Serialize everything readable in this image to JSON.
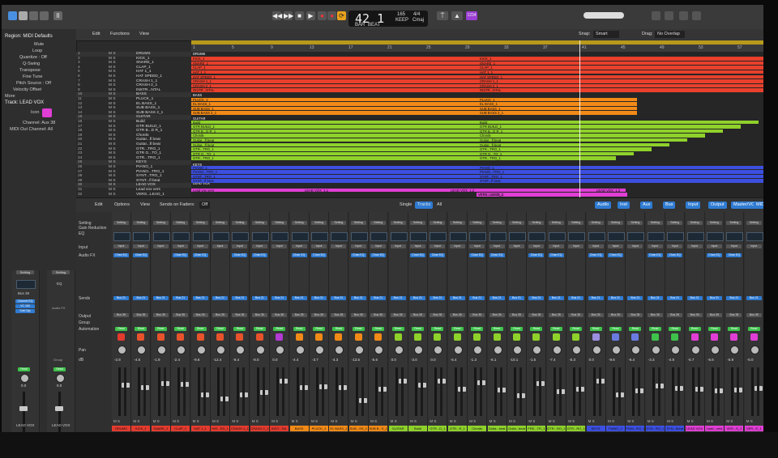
{
  "control_bar": {
    "position": "42 1",
    "bar_label": "BAR",
    "beat_label": "BEAT",
    "tempo": "165",
    "tempo_label": "KEEP",
    "time_signature": "4/4",
    "key": "Cmaj",
    "tempo_sub": "TEMPO",
    "cpu_badge": "1234",
    "transport_icons": [
      "rewind-icon",
      "forward-icon",
      "stop-icon",
      "play-icon",
      "record-icon",
      "capture-icon",
      "cycle-icon"
    ]
  },
  "inspector": {
    "region_header": "Region: MIDI Defaults",
    "rows": [
      "Mute",
      "Loop",
      "Quantize :  Off",
      "Q-Swing",
      "Transpose",
      "Fine Tune",
      "Pitch Source :  Off",
      "Velocity Offset",
      "More"
    ],
    "track_header": "Track:  LEAD VOX",
    "icon_label": "Icon",
    "channel": "Channel:  Aux 38",
    "midi_out": "MIDI Out Channel:  All",
    "strip1_name": "LEAD VOX",
    "strip2_name": "LEAD VOX",
    "bus": "Bus 39",
    "fx_label": "Audio FX",
    "eq_label": "EQ",
    "plugins": [
      "Channel EQ",
      "VC 160",
      "Soft Clip"
    ],
    "read": "Read",
    "vol1": "0.0",
    "vol2": "0.0",
    "group": "Group",
    "setting": "Setting"
  },
  "tracks_header": {
    "edit": "Edit",
    "functions": "Functions",
    "view": "View",
    "snap_label": "Snap:",
    "snap_value": "Smart",
    "drag_label": "Drag:",
    "drag_value": "No Overlap"
  },
  "ruler": [
    "1",
    "5",
    "9",
    "13",
    "17",
    "21",
    "25",
    "29",
    "33",
    "37",
    "41",
    "45",
    "49",
    "53",
    "57"
  ],
  "tracks": [
    {
      "n": "1",
      "name": "DRUMS"
    },
    {
      "n": "2",
      "name": "KICK_1"
    },
    {
      "n": "3",
      "name": "SNARE_1"
    },
    {
      "n": "4",
      "name": "CLAP_1"
    },
    {
      "n": "5",
      "name": "HAT 1_1"
    },
    {
      "n": "6",
      "name": "HAT SPEED_1"
    },
    {
      "n": "7",
      "name": "CRASH 1_1"
    },
    {
      "n": "8",
      "name": "CRASH 2_1"
    },
    {
      "n": "9",
      "name": "INSTR...NTAL"
    },
    {
      "n": "10",
      "name": "BASS"
    },
    {
      "n": "11",
      "name": "PLUCK_1"
    },
    {
      "n": "12",
      "name": "EL BASS_1"
    },
    {
      "n": "13",
      "name": "SUB BASS_1"
    },
    {
      "n": "14",
      "name": "SUB BASS 2_1"
    },
    {
      "n": "15",
      "name": "GUITAR"
    },
    {
      "n": "16",
      "name": "Build"
    },
    {
      "n": "17",
      "name": "GTR BUILD_1"
    },
    {
      "n": "18",
      "name": "GTR B...D R_1"
    },
    {
      "n": "19",
      "name": "Chords"
    },
    {
      "n": "20",
      "name": "Guitar...fl beat"
    },
    {
      "n": "21",
      "name": "Guitar...fl beat"
    },
    {
      "n": "22",
      "name": "GTR...TRO_1"
    },
    {
      "n": "23",
      "name": "GTR G...TO_1"
    },
    {
      "n": "24",
      "name": "GTR...TRO_1"
    },
    {
      "n": "25",
      "name": "KEYS"
    },
    {
      "n": "26",
      "name": "PIANO_1"
    },
    {
      "n": "27",
      "name": "PIANO...TRO_1"
    },
    {
      "n": "28",
      "name": "SYNT...TRO_1"
    },
    {
      "n": "29",
      "name": "SYNT...fl beat"
    },
    {
      "n": "30",
      "name": "LEAD VOX"
    },
    {
      "n": "31",
      "name": "Lead vox vers"
    },
    {
      "n": "32",
      "name": "VERS...LEAD_1"
    }
  ],
  "arrange_labels": {
    "drums": "DRUMS",
    "bass": "BASS",
    "guitar": "GUITAR",
    "keys": "KEYS",
    "lead": "LEAD VOX",
    "lead_regions": [
      "LEAD VOX_1.1",
      "LEAD VOX_1.2",
      "LEAD VOX_1.3"
    ],
    "vers": "VERS 1 LEAD_1"
  },
  "mixer_header": {
    "edit": "Edit",
    "options": "Options",
    "view": "View",
    "sends_on_faders": "Sends on Faders:",
    "sends_value": "Off",
    "modes": [
      "Single",
      "Tracks",
      "All"
    ],
    "filters": [
      "Audio",
      "Inst",
      "Aux",
      "Bus",
      "Input",
      "Output",
      "Master/VCA",
      "MIDI"
    ]
  },
  "mixer_row_labels": [
    "Setting",
    "Gain Reduction",
    "EQ",
    "Input",
    "Audio FX",
    "Sends",
    "Output",
    "Group",
    "Automation",
    "",
    "Pan",
    "dB"
  ],
  "strips": [
    {
      "name": "DRUMS",
      "color": "#e33b2e",
      "db": "-2.8",
      "icon": "#e33b2e"
    },
    {
      "name": "KICK_1",
      "color": "#e33b2e",
      "db": "-4.6",
      "icon": "#e8532b"
    },
    {
      "name": "SNARE_1",
      "color": "#e33b2e",
      "db": "-1.9",
      "icon": "#e8532b"
    },
    {
      "name": "CLAP_1",
      "color": "#e33b2e",
      "db": "-2.4",
      "icon": "#e8532b"
    },
    {
      "name": "HAT 1_1",
      "color": "#e33b2e",
      "db": "-9.6",
      "icon": "#e8532b"
    },
    {
      "name": "HAT...ED_1",
      "color": "#e33b2e",
      "db": "-12.4",
      "icon": "#e8532b"
    },
    {
      "name": "CRASH 1_1",
      "color": "#e33b2e",
      "db": "-9.4",
      "icon": "#e8532b"
    },
    {
      "name": "CRASH 2_1",
      "color": "#e33b2e",
      "db": "-8.0",
      "icon": "#e8532b"
    },
    {
      "name": "INST...TAL",
      "color": "#e33b2e",
      "db": "0.0",
      "icon": "#b23bd4"
    },
    {
      "name": "BASS",
      "color": "#f28a17",
      "db": "-4.4",
      "icon": "#f28a17"
    },
    {
      "name": "PLUCK_1",
      "color": "#f28a17",
      "db": "-3.7",
      "icon": "#f28a17"
    },
    {
      "name": "EL BASS_1",
      "color": "#f28a17",
      "db": "-4.3",
      "icon": "#f28a17"
    },
    {
      "name": "SUB...SS_1",
      "color": "#f28a17",
      "db": "-13.5",
      "icon": "#f28a17"
    },
    {
      "name": "SUB B...S_1",
      "color": "#f28a17",
      "db": "-5.6",
      "icon": "#f28a17"
    },
    {
      "name": "GUITAR",
      "color": "#8fd12b",
      "db": "0.0",
      "icon": "#8fd12b"
    },
    {
      "name": "Build",
      "color": "#8fd12b",
      "db": "-3.0",
      "icon": "#8fd12b"
    },
    {
      "name": "GTR...D_1",
      "color": "#8fd12b",
      "db": "0.0",
      "icon": "#8fd12b"
    },
    {
      "name": "GTR...R_1",
      "color": "#8fd12b",
      "db": "-5.4",
      "icon": "#8fd12b"
    },
    {
      "name": "Chords",
      "color": "#8fd12b",
      "db": "-1.3",
      "icon": "#8fd12b"
    },
    {
      "name": "Guita...beat",
      "color": "#8fd12b",
      "db": "-6.1",
      "icon": "#8fd12b"
    },
    {
      "name": "Guita...beat",
      "color": "#8fd12b",
      "db": "-10.1",
      "icon": "#8fd12b"
    },
    {
      "name": "FRE...TR_1",
      "color": "#8fd12b",
      "db": "-1.5",
      "icon": "#8fd12b"
    },
    {
      "name": "GTR...RO_1",
      "color": "#8fd12b",
      "db": "-7.4",
      "icon": "#8fd12b"
    },
    {
      "name": "GTR...RO_1",
      "color": "#8fd12b",
      "db": "-5.3",
      "icon": "#8fd12b"
    },
    {
      "name": "KEYS",
      "color": "#3c4fe0",
      "db": "0.0",
      "icon": "#9b8fe0"
    },
    {
      "name": "PIANO_1",
      "color": "#3c4fe0",
      "db": "-9.6",
      "icon": "#6a7be0"
    },
    {
      "name": "PIAN...RO_1",
      "color": "#3c4fe0",
      "db": "-6.4",
      "icon": "#6a7be0"
    },
    {
      "name": "SYN...RO_1",
      "color": "#3c4fe0",
      "db": "-3.3",
      "icon": "#3ec24b"
    },
    {
      "name": "SYN...fbeat",
      "color": "#3c4fe0",
      "db": "-4.8",
      "icon": "#3ec24b"
    },
    {
      "name": "LEAD VOX",
      "color": "#e03ed4",
      "db": "-5.7",
      "icon": "#e03ed4"
    },
    {
      "name": "Lead...vers",
      "color": "#e03ed4",
      "db": "-6.6",
      "icon": "#e03ed4"
    },
    {
      "name": "VER...S_1",
      "color": "#e03ed4",
      "db": "-5.9",
      "icon": "#e03ed4"
    },
    {
      "name": "VER...E_1",
      "color": "#e03ed4",
      "db": "-5.0",
      "icon": "#e03ed4"
    }
  ],
  "strip_common": {
    "read": "Read",
    "setting": "Setting",
    "input": "Input",
    "output": "Bus 35",
    "eq": "Chan EQ",
    "send": "Bus 21",
    "ms": "M S"
  }
}
